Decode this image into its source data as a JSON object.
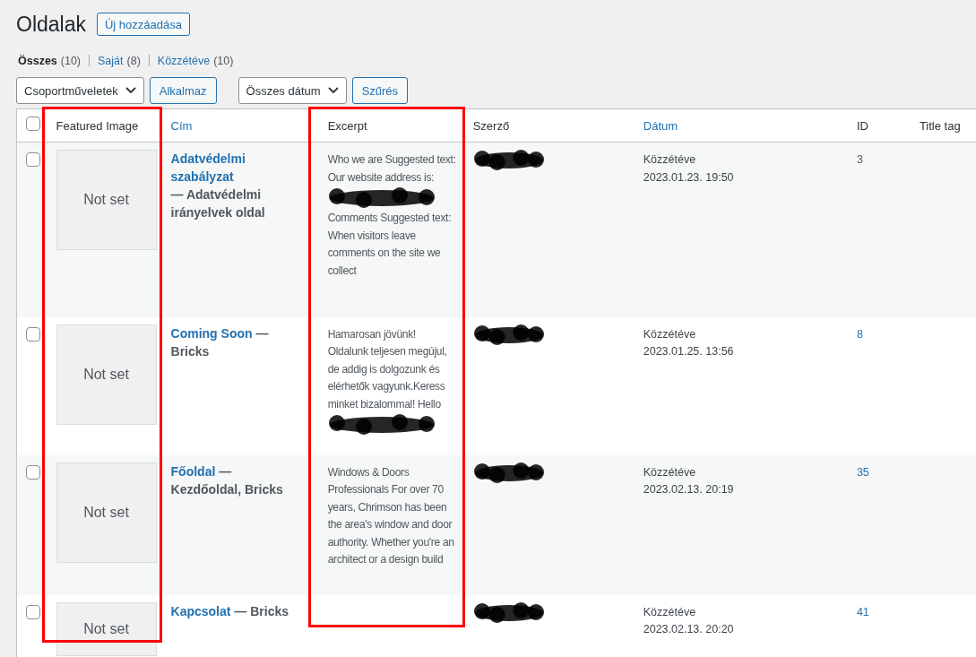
{
  "page": {
    "title": "Oldalak",
    "add_button": "Új hozzáadása"
  },
  "views": [
    {
      "label": "Összes",
      "count": "(10)",
      "selected": true
    },
    {
      "label": "Saját",
      "count": "(8)",
      "selected": false
    },
    {
      "label": "Közzétéve",
      "count": "(10)",
      "selected": false
    }
  ],
  "bulk_actions": {
    "select": "Csoportműveletek",
    "apply": "Alkalmaz"
  },
  "date_filter": {
    "select": "Összes dátum",
    "filter": "Szűrés"
  },
  "table": {
    "select_all_checked": false,
    "columns": [
      {
        "label": "Featured Image",
        "sortable": false,
        "highlighted": true
      },
      {
        "label": "Cím",
        "sortable": true,
        "highlighted": false
      },
      {
        "label": "Excerpt",
        "sortable": false,
        "highlighted": true
      },
      {
        "label": "Szerző",
        "sortable": false
      },
      {
        "label": "Dátum",
        "sortable": true
      },
      {
        "label": "ID",
        "sortable": false
      },
      {
        "label": "Title tag",
        "sortable": false
      }
    ],
    "rows": [
      {
        "checked": false,
        "image": "Not set",
        "title": "Adatvédelmi szabályzat",
        "state": " — Adatvédelmi irányelvek oldal",
        "excerpt": [
          {
            "kind": "text",
            "text": "Who we are Suggested text: Our website address is:"
          },
          {
            "kind": "redaction"
          },
          {
            "kind": "text",
            "text": "Comments Suggested text: When visitors leave comments on the site we collect"
          }
        ],
        "status": "Közzétéve",
        "date": "2023.01.23. 19:50",
        "id": "3"
      },
      {
        "checked": false,
        "image": "Not set",
        "title": "Coming Soon",
        "state": " — Bricks",
        "excerpt": [
          {
            "kind": "text",
            "text": "Hamarosan jövünk! Oldalunk teljesen megújul, de addig is dolgozunk és elérhetők vagyunk.Keress minket bizalommal! Hello"
          },
          {
            "kind": "redaction"
          }
        ],
        "status": "Közzétéve",
        "date": "2023.01.25. 13:56",
        "id": "8"
      },
      {
        "checked": false,
        "image": "Not set",
        "title": "Főoldal",
        "state": " — Kezdőoldal, Bricks",
        "excerpt": [
          {
            "kind": "text",
            "text": "Windows & Doors Professionals For over 70 years, Chrimson has been the area's window and door authority. Whether you're an architect or a design build"
          }
        ],
        "status": "Közzétéve",
        "date": "2023.02.13. 20:19",
        "id": "35"
      },
      {
        "checked": false,
        "image": "Not set",
        "title": "Kapcsolat",
        "state": " — Bricks",
        "excerpt": [],
        "status": "Közzétéve",
        "date": "2023.02.13. 20:20",
        "id": "41"
      }
    ]
  }
}
